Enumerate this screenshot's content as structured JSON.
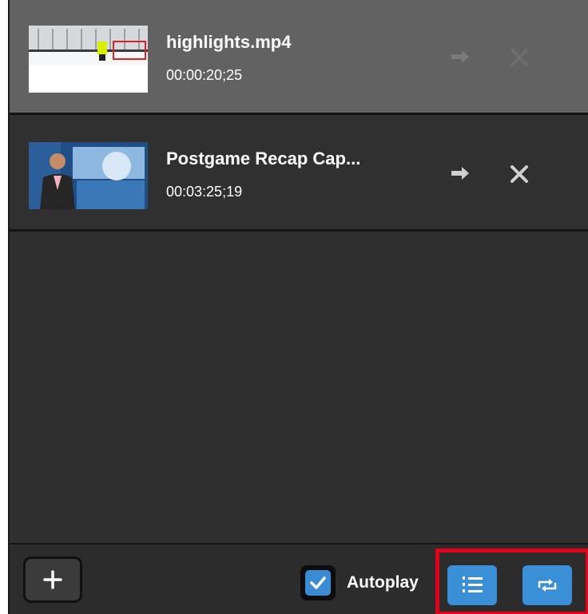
{
  "playlist": {
    "items": [
      {
        "title": "highlights.mp4",
        "duration": "00:00:20;25",
        "selected": true
      },
      {
        "title": "Postgame Recap Cap...",
        "duration": "00:03:25;19",
        "selected": false
      }
    ]
  },
  "footer": {
    "autoplay_label": "Autoplay",
    "autoplay_checked": true
  },
  "icons": {
    "send": "arrow-right-icon",
    "remove": "close-icon",
    "add": "plus-icon",
    "playlist_mode": "numbered-list-icon",
    "loop_mode": "repeat-icon"
  },
  "colors": {
    "panel": "#2f2f2f",
    "selected_row": "#626262",
    "accent": "#3a8fd6",
    "highlight": "#e3001b"
  }
}
